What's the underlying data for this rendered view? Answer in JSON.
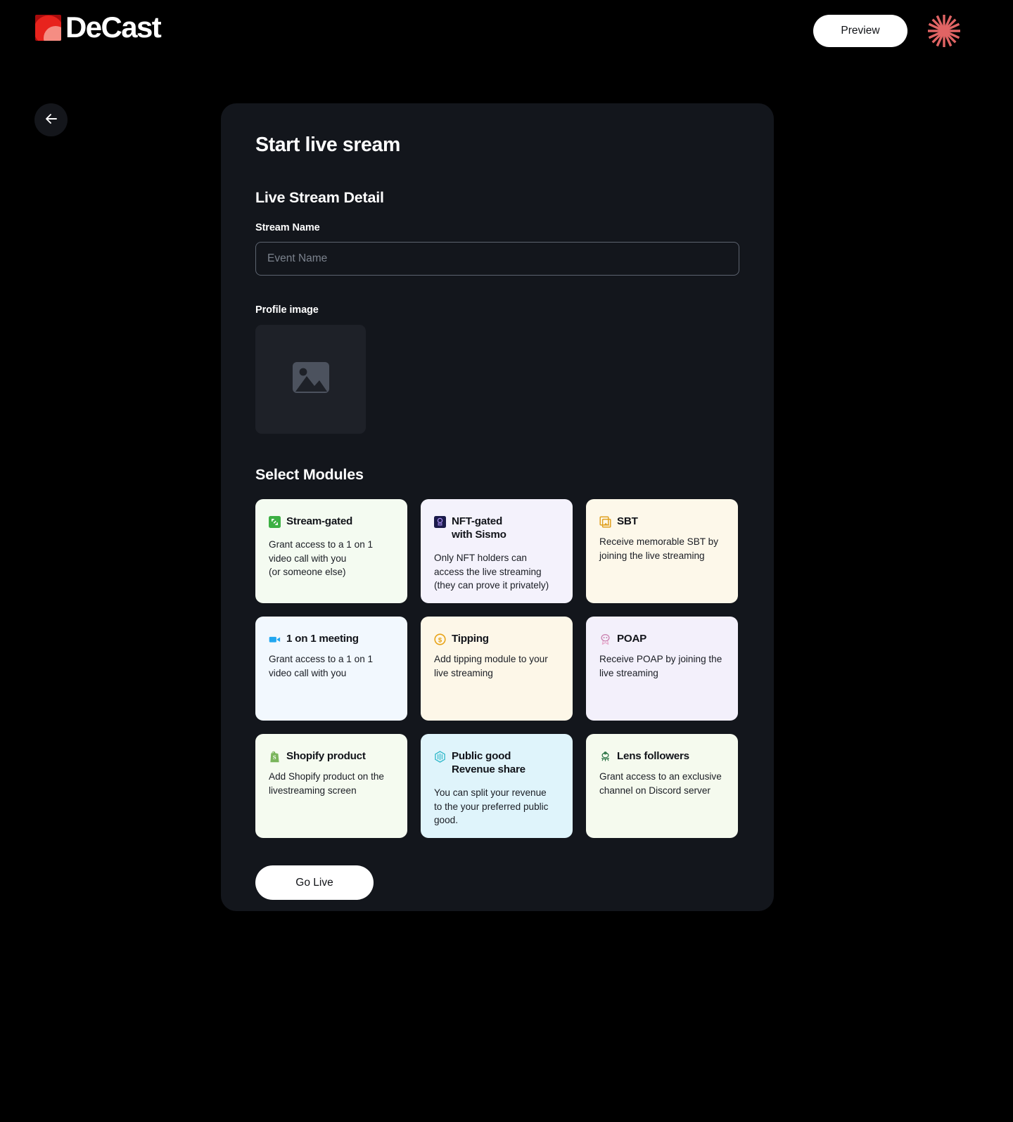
{
  "brand": {
    "name": "DeCast",
    "mark_colors": {
      "base": "#a80c0c",
      "mid": "#e8231d",
      "light": "#f58d83"
    }
  },
  "topbar": {
    "preview_label": "Preview",
    "burst_icon": "asterisk-burst-icon",
    "burst_color": "#e06464"
  },
  "nav": {
    "back_icon": "arrow-left-icon"
  },
  "main": {
    "page_title": "Start live sream",
    "detail_section_title": "Live Stream Detail",
    "stream_name_label": "Stream Name",
    "stream_name_value": "",
    "stream_name_placeholder": "Event Name",
    "profile_image_label": "Profile image",
    "profile_image_icon": "image-placeholder-icon",
    "modules_section_title": "Select Modules",
    "go_live_label": "Go Live"
  },
  "modules": [
    {
      "id": "stream-gated",
      "title": "Stream-gated",
      "desc": "Grant access to a 1 on 1\nvideo call with you\n(or someone else)",
      "bg": "#f4fbf1",
      "icon": "stream-gated-icon",
      "icon_color": "#3cb043",
      "selected": false
    },
    {
      "id": "nft-gated-with-sismo",
      "title": "NFT-gated\nwith Sismo",
      "desc": "Only NFT holders can\naccess the live streaming\n(they can prove it privately)",
      "bg": "#f4f2fc",
      "icon": "sismo-icon",
      "icon_color": "#1b1b4b",
      "selected": false
    },
    {
      "id": "sbt",
      "title": "SBT",
      "desc": "Receive memorable SBT by\njoining the live streaming",
      "bg": "#fdf8ea",
      "icon": "sbt-stacked-images-icon",
      "icon_color": "#e0a020",
      "selected": false
    },
    {
      "id": "1-on-1-meeting",
      "title": "1 on 1 meeting",
      "desc": "Grant access to a 1 on 1\nvideo call with you",
      "bg": "#f2f8fe",
      "icon": "video-camera-icon",
      "icon_color": "#22a7f0",
      "selected": false
    },
    {
      "id": "tipping",
      "title": "Tipping",
      "desc": "Add tipping module to your\nlive streaming",
      "bg": "#fdf7e8",
      "icon": "coin-dollar-icon",
      "icon_color": "#e8a317",
      "selected": false
    },
    {
      "id": "poap",
      "title": "POAP",
      "desc": "Receive POAP by joining the\nlive streaming",
      "bg": "#f3f0fb",
      "icon": "poap-badge-icon",
      "icon_color": "#d98fb8",
      "selected": false
    },
    {
      "id": "shopify-product",
      "title": "Shopify product",
      "desc": "Add Shopify product on the\nlivestreaming screen",
      "bg": "#f5fbf0",
      "icon": "shopify-bag-icon",
      "icon_color": "#7ab55c",
      "selected": false
    },
    {
      "id": "public-good-revenue-share",
      "title": "Public good\nRevenue share",
      "desc": "You can split your revenue\nto the your preferred public\ngood.",
      "bg": "#dff4fb",
      "icon": "hexagon-cube-icon",
      "icon_color": "#2ab6c8",
      "selected": true
    },
    {
      "id": "lens-followers",
      "title": "Lens followers",
      "desc": "Grant access to an exclusive\nchannel on Discord server",
      "bg": "#f5faee",
      "icon": "lens-tree-icon",
      "icon_color": "#1f6b3a",
      "selected": false
    }
  ]
}
